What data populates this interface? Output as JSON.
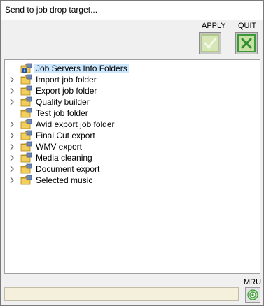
{
  "window": {
    "title": "Send to job drop target..."
  },
  "toolbar": {
    "apply_label": "APPLY",
    "quit_label": "QUIT",
    "apply_icon": "checkmark-icon",
    "quit_icon": "close-x-icon"
  },
  "tree": {
    "items": [
      {
        "label": "Job Servers Info Folders",
        "has_children": false,
        "selected": true,
        "icon": "info-folder-icon"
      },
      {
        "label": "Import job folder",
        "has_children": true,
        "selected": false,
        "icon": "folder-icon"
      },
      {
        "label": "Export job folder",
        "has_children": true,
        "selected": false,
        "icon": "folder-icon"
      },
      {
        "label": "Quality builder",
        "has_children": true,
        "selected": false,
        "icon": "folder-icon"
      },
      {
        "label": "Test job folder",
        "has_children": false,
        "selected": false,
        "icon": "folder-icon"
      },
      {
        "label": "Avid export job folder",
        "has_children": true,
        "selected": false,
        "icon": "folder-icon"
      },
      {
        "label": "Final Cut export",
        "has_children": true,
        "selected": false,
        "icon": "folder-icon"
      },
      {
        "label": "WMV export",
        "has_children": true,
        "selected": false,
        "icon": "folder-icon"
      },
      {
        "label": "Media cleaning",
        "has_children": true,
        "selected": false,
        "icon": "folder-icon"
      },
      {
        "label": "Document export",
        "has_children": true,
        "selected": false,
        "icon": "folder-icon"
      },
      {
        "label": "Selected music",
        "has_children": true,
        "selected": false,
        "icon": "folder-icon"
      }
    ]
  },
  "footer": {
    "status_text": "",
    "mru_label": "MRU",
    "mru_icon": "target-icon"
  },
  "colors": {
    "selection": "#cce8ff",
    "button_green": "#3a9a3a",
    "status_bg": "#f5f0dc"
  }
}
